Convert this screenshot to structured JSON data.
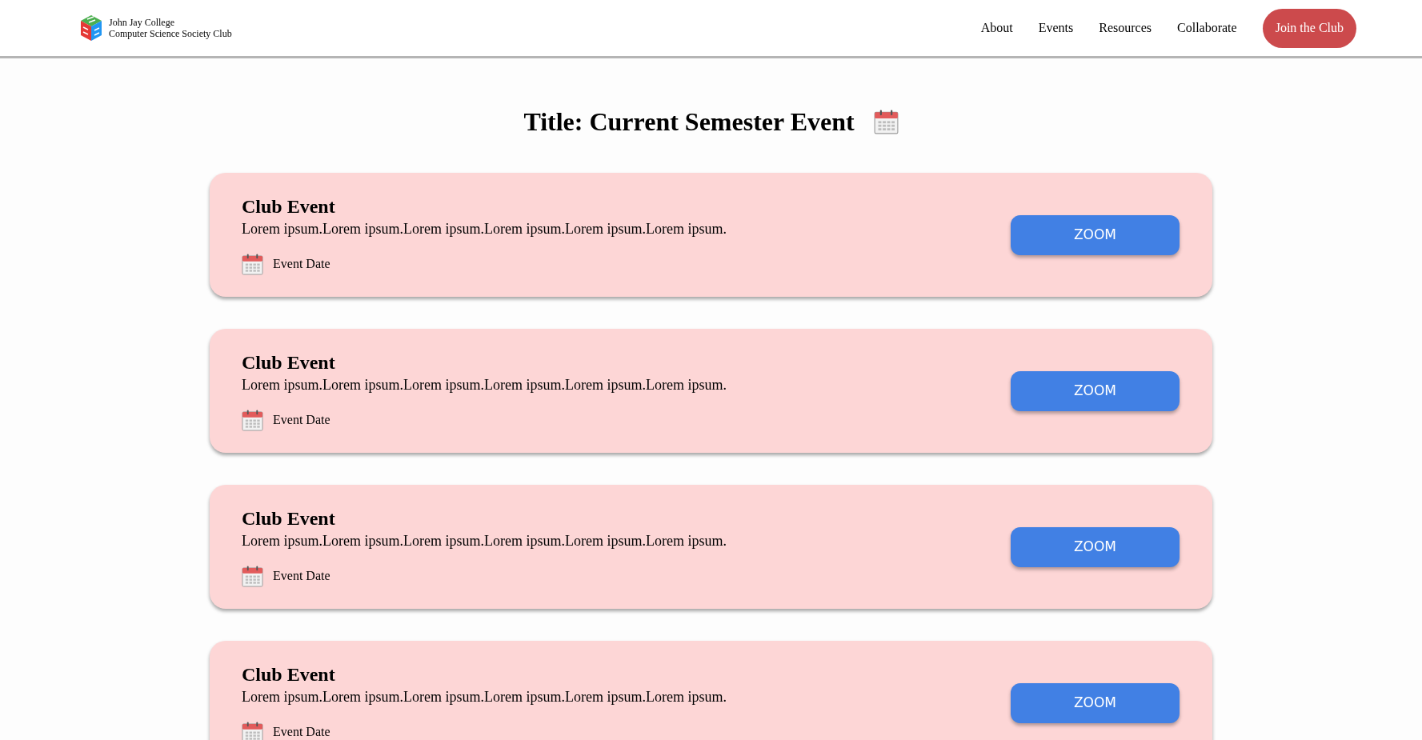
{
  "header": {
    "logo_lines": [
      "John Jay College",
      "Computer Science Society Club"
    ],
    "nav": [
      "About",
      "Events",
      "Resources",
      "Collaborate"
    ],
    "cta": "Join the Club"
  },
  "title": "Title: Current Semester Event",
  "events": [
    {
      "title": "Club Event",
      "description": "Lorem ipsum.Lorem ipsum.Lorem ipsum.Lorem ipsum.Lorem ipsum.Lorem ipsum.",
      "date": "Event Date",
      "button": "ZOOM"
    },
    {
      "title": "Club Event",
      "description": "Lorem ipsum.Lorem ipsum.Lorem ipsum.Lorem ipsum.Lorem ipsum.Lorem ipsum.",
      "date": "Event Date",
      "button": "ZOOM"
    },
    {
      "title": "Club Event",
      "description": "Lorem ipsum.Lorem ipsum.Lorem ipsum.Lorem ipsum.Lorem ipsum.Lorem ipsum.",
      "date": "Event Date",
      "button": "ZOOM"
    },
    {
      "title": "Club Event",
      "description": "Lorem ipsum.Lorem ipsum.Lorem ipsum.Lorem ipsum.Lorem ipsum.Lorem ipsum.",
      "date": "Event Date",
      "button": "ZOOM"
    }
  ]
}
